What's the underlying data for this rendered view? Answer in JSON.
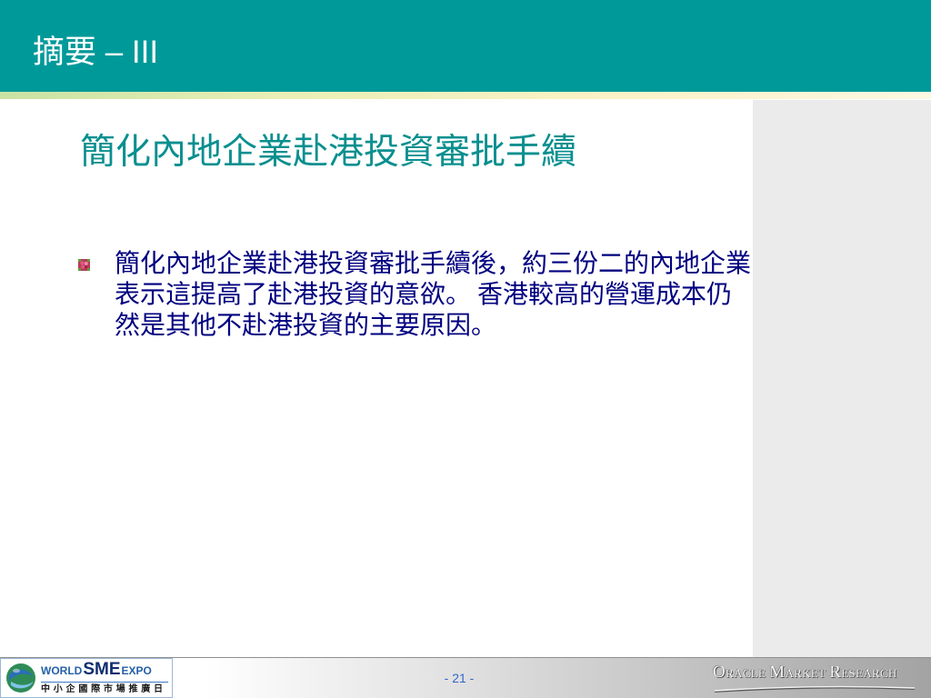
{
  "header": {
    "title": "摘要 – III"
  },
  "slide": {
    "subtitle": "簡化內地企業赴港投資審批手續",
    "bullet": {
      "icon": "bullet-square-icon",
      "lines": [
        "簡化內地企業赴港投資審批手續後，約三份二的內地企業",
        "表示這提高了赴港投資的意欲。 香港較高的營運成本仍",
        "然是其他不赴港投資的主要原因。"
      ]
    }
  },
  "footer": {
    "page_number": "- 21 -",
    "left_logo": {
      "icon": "globe-icon",
      "world": "WORLD",
      "sme": "SME",
      "expo": "EXPO",
      "chinese": "中 小 企 國 際 市 場 推 廣 日"
    },
    "right_logo": {
      "words": [
        "ORACLE",
        "MARKET",
        "RESEARCH"
      ]
    }
  },
  "colors": {
    "header": "#009999",
    "subtitle": "#0a8f8f",
    "body_text": "#000080",
    "page_number": "#3366cc",
    "side_panel": "#ebebeb"
  }
}
